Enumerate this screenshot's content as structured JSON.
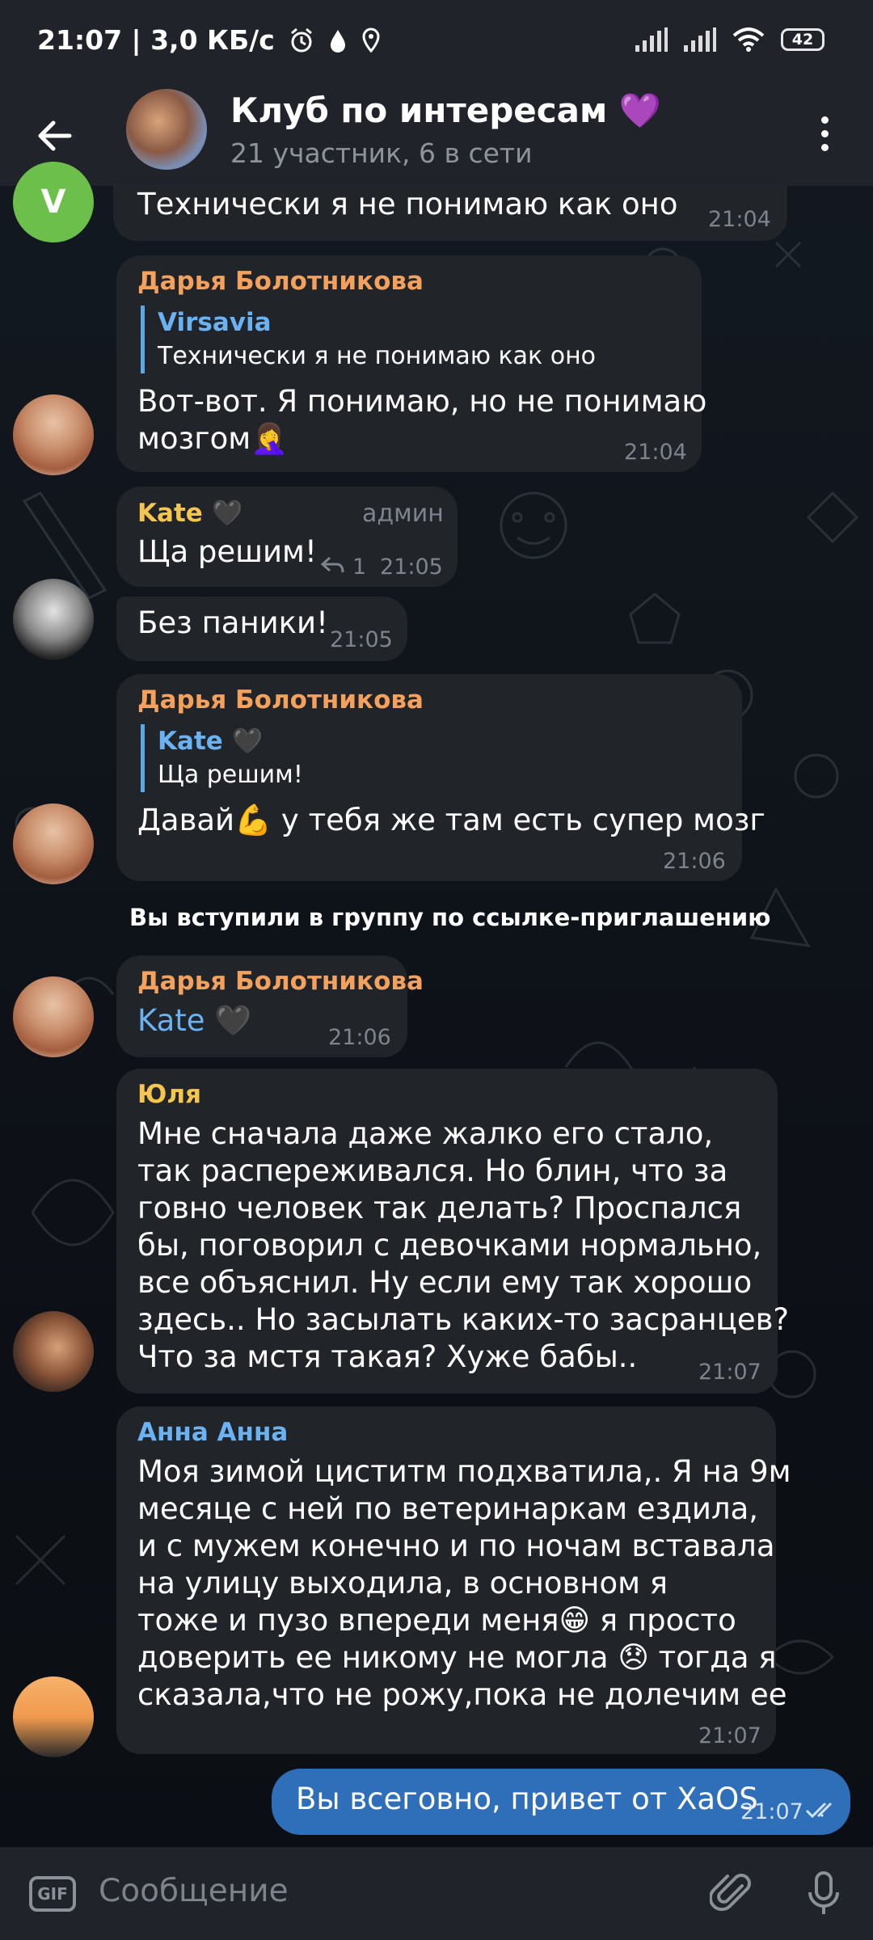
{
  "status_bar": {
    "time_speed": "21:07 | 3,0 КБ/с",
    "battery": "42"
  },
  "header": {
    "title": "Клуб по интересам 💜",
    "subtitle": "21 участник, 6 в сети",
    "icons": [
      "back-arrow-icon",
      "group-avatar",
      "more-vert-icon"
    ]
  },
  "messages": [
    {
      "avatar": "V",
      "text": "Технически я не понимаю как оно",
      "time": "21:04"
    },
    {
      "sender": "Дарья Болотникова",
      "sender_color": "#f3a15c",
      "reply": {
        "name": "Virsavia",
        "text": "Технически я не понимаю как оно"
      },
      "lines": [
        "Вот-вот. Я понимаю, но не понимаю",
        "мозгом🤦‍♀️"
      ],
      "time": "21:04"
    },
    {
      "sender": "Kate 🖤",
      "sender_color": "#f4c54f",
      "badge": "админ",
      "text": "Ща решим!",
      "replies": "1",
      "time": "21:05"
    },
    {
      "text": "Без паники!",
      "time": "21:05"
    },
    {
      "sender": "Дарья Болотникова",
      "sender_color": "#f3a15c",
      "reply": {
        "name": "Kate 🖤",
        "text": "Ща решим!"
      },
      "text": "Давай💪 у тебя же там есть супер мозг",
      "time": "21:06"
    },
    {
      "service": "Вы вступили в группу по ссылке-приглашению"
    },
    {
      "sender": "Дарья Болотникова",
      "sender_color": "#f3a15c",
      "mention": "Kate 🖤",
      "time": "21:06"
    },
    {
      "sender": "Юля",
      "sender_color": "#f4c54f",
      "lines": [
        "Мне сначала даже жалко его стало,",
        "так распереживался. Но блин, что за",
        "говно человек так делать? Проспался",
        "бы, поговорил с девочками нормально,",
        "все объяснил. Ну если ему так хорошо",
        "здесь.. Но засылать каких-то засранцев?",
        "Что за мстя такая? Хуже бабы.."
      ],
      "time": "21:07"
    },
    {
      "sender": "Анна Анна",
      "sender_color": "#6ab2f2",
      "lines": [
        "Моя зимой циститм подхватила,. Я на 9м",
        "месяце с ней по ветеринаркам ездила,",
        "и с мужем конечно и по ночам вставала",
        "на улицу выходила,  в основном я",
        "тоже и пузо впереди меня😁 я  просто",
        "доверить ее никому не могла 😞 тогда я",
        "сказала,что не рожу,пока не долечим ее"
      ],
      "time": "21:07"
    },
    {
      "outgoing": true,
      "text": "Вы всеговно, привет от XaOS",
      "time": "21:07"
    }
  ],
  "input": {
    "gif_label": "GIF",
    "placeholder": "Сообщение",
    "icons": [
      "gif-icon",
      "attach-icon",
      "mic-icon"
    ]
  },
  "colors": {
    "header_bg": "#202329",
    "bubble_in": "#212429",
    "bubble_out": "#2f6eb8",
    "accent": "#6ab2f2"
  }
}
